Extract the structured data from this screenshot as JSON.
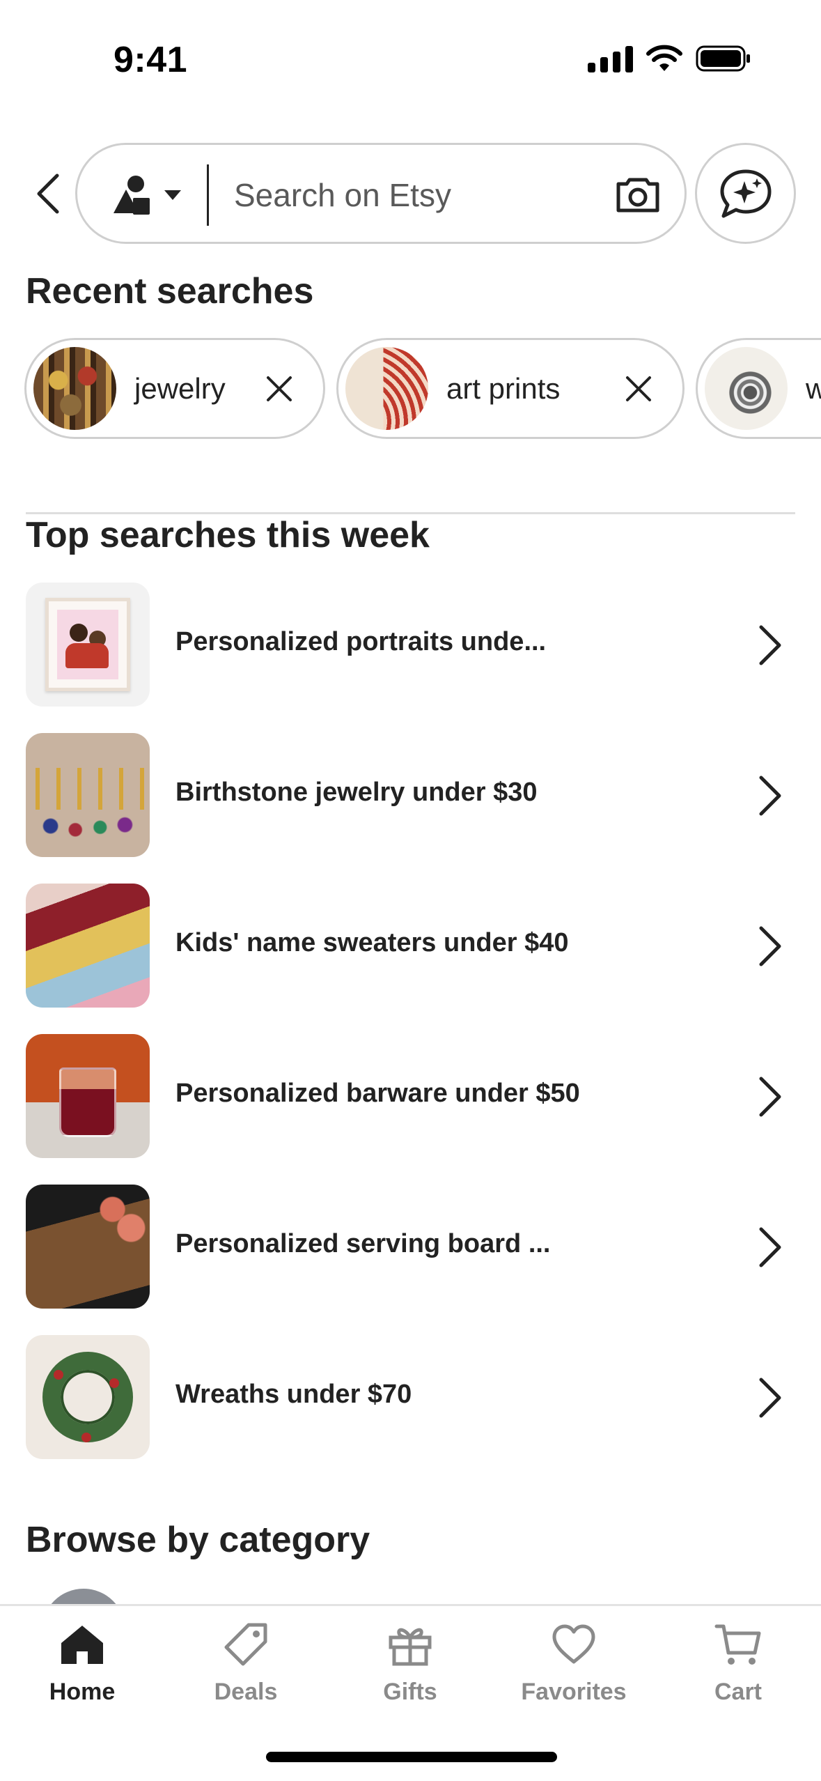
{
  "status_bar": {
    "time": "9:41"
  },
  "search": {
    "placeholder": "Search on Etsy"
  },
  "recent": {
    "title": "Recent searches",
    "chips": [
      {
        "label": "jewelry"
      },
      {
        "label": "art prints"
      },
      {
        "label": "wa"
      }
    ]
  },
  "top": {
    "title": "Top searches this week",
    "items": [
      {
        "label": "Personalized portraits unde..."
      },
      {
        "label": "Birthstone jewelry under $30"
      },
      {
        "label": "Kids' name sweaters under $40"
      },
      {
        "label": "Personalized barware under $50"
      },
      {
        "label": "Personalized serving board ..."
      },
      {
        "label": "Wreaths under $70"
      }
    ]
  },
  "browse": {
    "title": "Browse by category"
  },
  "tabs": [
    {
      "label": "Home",
      "icon": "home-icon",
      "active": true
    },
    {
      "label": "Deals",
      "icon": "tag-icon",
      "active": false
    },
    {
      "label": "Gifts",
      "icon": "gift-icon",
      "active": false
    },
    {
      "label": "Favorites",
      "icon": "heart-icon",
      "active": false
    },
    {
      "label": "Cart",
      "icon": "cart-icon",
      "active": false
    }
  ],
  "colors": {
    "text": "#222222",
    "muted": "#8a8a8a",
    "border": "#cfcfcf"
  }
}
